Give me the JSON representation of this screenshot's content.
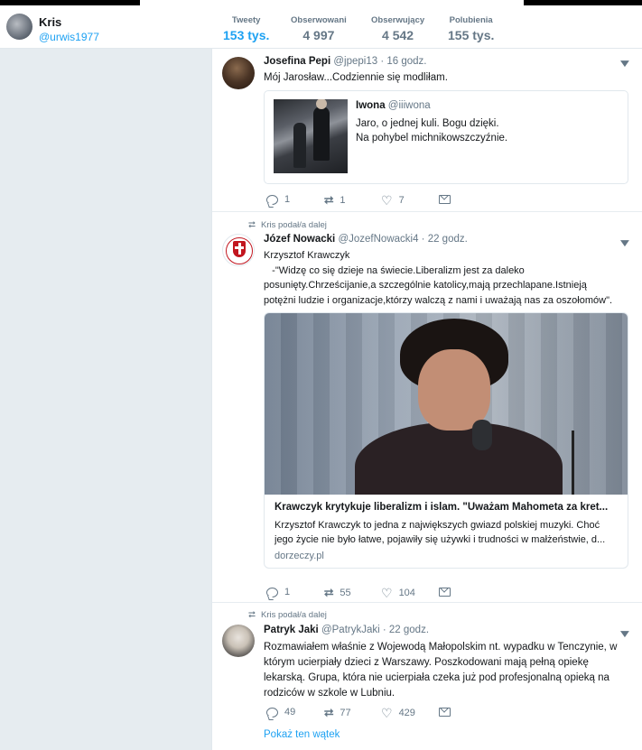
{
  "profile": {
    "name": "Kris",
    "handle": "@urwis1977"
  },
  "stats": [
    {
      "label": "Tweety",
      "value": "153 tys."
    },
    {
      "label": "Obserwowani",
      "value": "4 997"
    },
    {
      "label": "Obserwujący",
      "value": "4 542"
    },
    {
      "label": "Polubienia",
      "value": "155 tys."
    }
  ],
  "tweets": [
    {
      "name": "Josefina Pepi",
      "handle": "@jpepi13",
      "time": "· 16 godz.",
      "text": "Mój Jarosław...Codziennie się modliłam.",
      "quote": {
        "name": "Iwona",
        "handle": "@iiiwona",
        "line1": "Jaro, o jednej kuli. Bogu dzięki.",
        "line2": "Na pohybel michnikowszczyźnie."
      },
      "replies": "1",
      "retweets": "1",
      "likes": "7"
    },
    {
      "retweeted_by": "Kris podał/a dalej",
      "name": "Józef Nowacki",
      "handle": "@JozefNowacki4",
      "time": "· 22 godz.",
      "line1": "Krzysztof Krawczyk",
      "line2": "   -\"Widzę co się dzieje na świecie.Liberalizm jest za daleko",
      "line3": "posunięty.Chrześcijanie,a szczególnie katolicy,mają przechlapane.Istnieją",
      "line4": "potężni ludzie i organizacje,którzy walczą z nami i uważają nas za oszołomów\".",
      "card": {
        "title": "Krawczyk krytykuje liberalizm i islam. \"Uważam Mahometa za kret...",
        "desc1": "Krzysztof Krawczyk to jedna z największych gwiazd polskiej muzyki. Choć",
        "desc2": "jego życie nie było łatwe, pojawiły się używki i trudności w małżeństwie, d...",
        "domain": "dorzeczy.pl"
      },
      "replies": "1",
      "retweets": "55",
      "likes": "104"
    },
    {
      "retweeted_by": "Kris podał/a dalej",
      "name": "Patryk Jaki",
      "handle": "@PatrykJaki",
      "time": "· 22 godz.",
      "line1": "Rozmawiałem właśnie z Wojewodą Małopolskim nt. wypadku w Tenczynie, w",
      "line2": "którym ucierpiały dzieci z Warszawy. Poszkodowani mają pełną opiekę",
      "line3": "lekarską. Grupa, która nie ucierpiała czeka już pod profesjonalną opieką na",
      "line4": "rodziców w szkole w Lubniu.",
      "replies": "49",
      "retweets": "77",
      "likes": "429",
      "show_thread": "Pokaż ten wątek"
    }
  ],
  "icons": {
    "chevron": "▼",
    "retweet": "⮂",
    "like": "♡"
  }
}
